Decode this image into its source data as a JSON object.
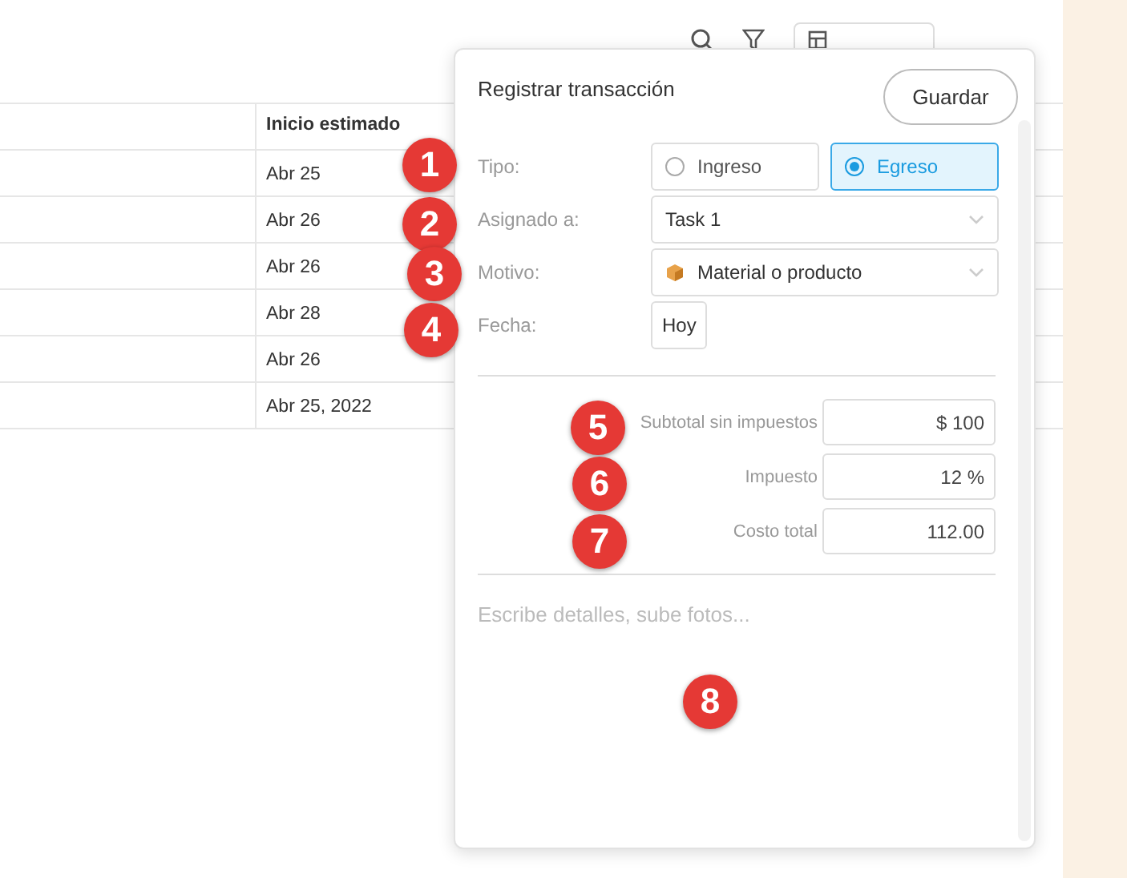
{
  "table": {
    "header": "Inicio estimado",
    "rows": [
      "Abr 25",
      "Abr 26",
      "Abr 26",
      "Abr 28",
      "Abr 26",
      "Abr 25, 2022"
    ]
  },
  "dialog": {
    "title": "Registrar transacción",
    "save_button": "Guardar",
    "fields": [
      {
        "kind": "radio",
        "label": "Tipo:",
        "options": [
          {
            "label": "Ingreso",
            "selected": false
          },
          {
            "label": "Egreso",
            "selected": true
          }
        ]
      },
      {
        "kind": "select",
        "label": "Asignado a:",
        "value": "Task 1",
        "has_icon": false
      },
      {
        "kind": "select",
        "label": "Motivo:",
        "value": "Material o producto",
        "has_icon": true
      },
      {
        "kind": "button",
        "label": "Fecha:",
        "value": "Hoy"
      }
    ],
    "totals": [
      {
        "label": "Subtotal sin impuestos",
        "value": "$ 100"
      },
      {
        "label": "Impuesto",
        "value": "12 %"
      },
      {
        "label": "Costo total",
        "value": "112.00"
      }
    ],
    "details": {
      "placeholder": "Escribe detalles, sube fotos..."
    }
  },
  "markers": [
    "1",
    "2",
    "3",
    "4",
    "5",
    "6",
    "7",
    "8"
  ]
}
